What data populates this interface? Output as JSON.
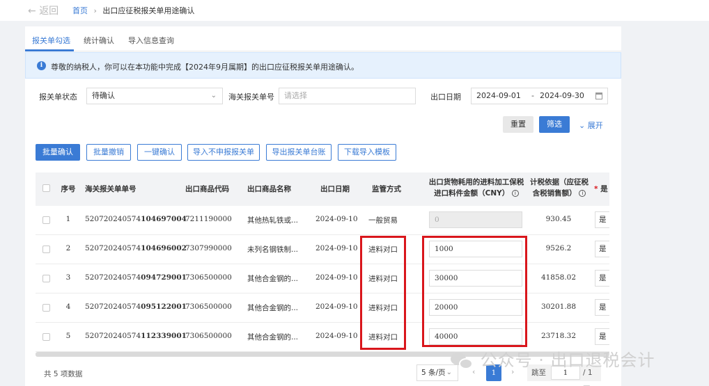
{
  "nav": {
    "back_label": "返回",
    "home": "首页",
    "sep": "›",
    "current": "出口应征税报关单用途确认"
  },
  "tabs": [
    {
      "label": "报关单勾选"
    },
    {
      "label": "统计确认"
    },
    {
      "label": "导入信息查询"
    }
  ],
  "notice": "尊敬的纳税人，你可以在本功能中完成【2024年9月属期】的出口应征税报关单用途确认。",
  "filters": {
    "status_label": "报关单状态",
    "status_value": "待确认",
    "customs_label": "海关报关单号",
    "customs_placeholder": "请选择",
    "date_label": "出口日期",
    "date_from": "2024-09-01",
    "date_sep": "-",
    "date_to": "2024-09-30"
  },
  "actions": {
    "reset": "重置",
    "filter": "筛选",
    "expand": "展开"
  },
  "toolbar": [
    "批量确认",
    "批量撤销",
    "一键确认",
    "导入不申报报关单",
    "导出报关单台账",
    "下载导入模板"
  ],
  "columns": {
    "seq": "序号",
    "customs_no": "海关报关单单号",
    "code": "出口商品代码",
    "name": "出口商品名称",
    "date": "出口日期",
    "supervision": "监管方式",
    "amount_l1": "出口货物耗用的进料加工保税",
    "amount_l2": "进口料件金额（CNY）",
    "tax_l1": "计税依据（应征税",
    "tax_l2": "含税销售额）",
    "yes_star": "*",
    "yes": "是"
  },
  "rows": [
    {
      "seq": "1",
      "no_prefix": "520720240574",
      "no_suffix": "104697004",
      "code": "7211190000",
      "name": "其他热轧铁或...",
      "date": "2024-09-10",
      "supervision": "一般贸易",
      "amount": "0",
      "amount_disabled": true,
      "tax": "930.45",
      "yes": "是"
    },
    {
      "seq": "2",
      "no_prefix": "520720240574",
      "no_suffix": "104696002",
      "code": "7307990000",
      "name": "未列名钢铁制...",
      "date": "2024-09-10",
      "supervision": "进料对口",
      "amount": "1000",
      "amount_disabled": false,
      "tax": "9526.2",
      "yes": "是"
    },
    {
      "seq": "3",
      "no_prefix": "520720240574",
      "no_suffix": "094729001",
      "code": "7306500000",
      "name": "其他合金钢的...",
      "date": "2024-09-10",
      "supervision": "进料对口",
      "amount": "30000",
      "amount_disabled": false,
      "tax": "41858.02",
      "yes": "是"
    },
    {
      "seq": "4",
      "no_prefix": "520720240574",
      "no_suffix": "095122001",
      "code": "7306500000",
      "name": "其他合金钢的...",
      "date": "2024-09-10",
      "supervision": "进料对口",
      "amount": "20000",
      "amount_disabled": false,
      "tax": "30201.88",
      "yes": "是"
    },
    {
      "seq": "5",
      "no_prefix": "520720240574",
      "no_suffix": "112339001",
      "code": "7306500000",
      "name": "其他合金钢的...",
      "date": "2024-09-10",
      "supervision": "进料对口",
      "amount": "40000",
      "amount_disabled": false,
      "tax": "23718.32",
      "yes": "是"
    }
  ],
  "pagination": {
    "total": "共 5 项数据",
    "page_size": "5 条/页",
    "current": "1",
    "jump_label": "跳至",
    "jump_value": "1",
    "total_pages": "/ 1 页"
  },
  "watermark": "公众号 · 出口退税会计",
  "colors": {
    "accent": "#3a7bd5",
    "highlight": "#d9161c"
  }
}
